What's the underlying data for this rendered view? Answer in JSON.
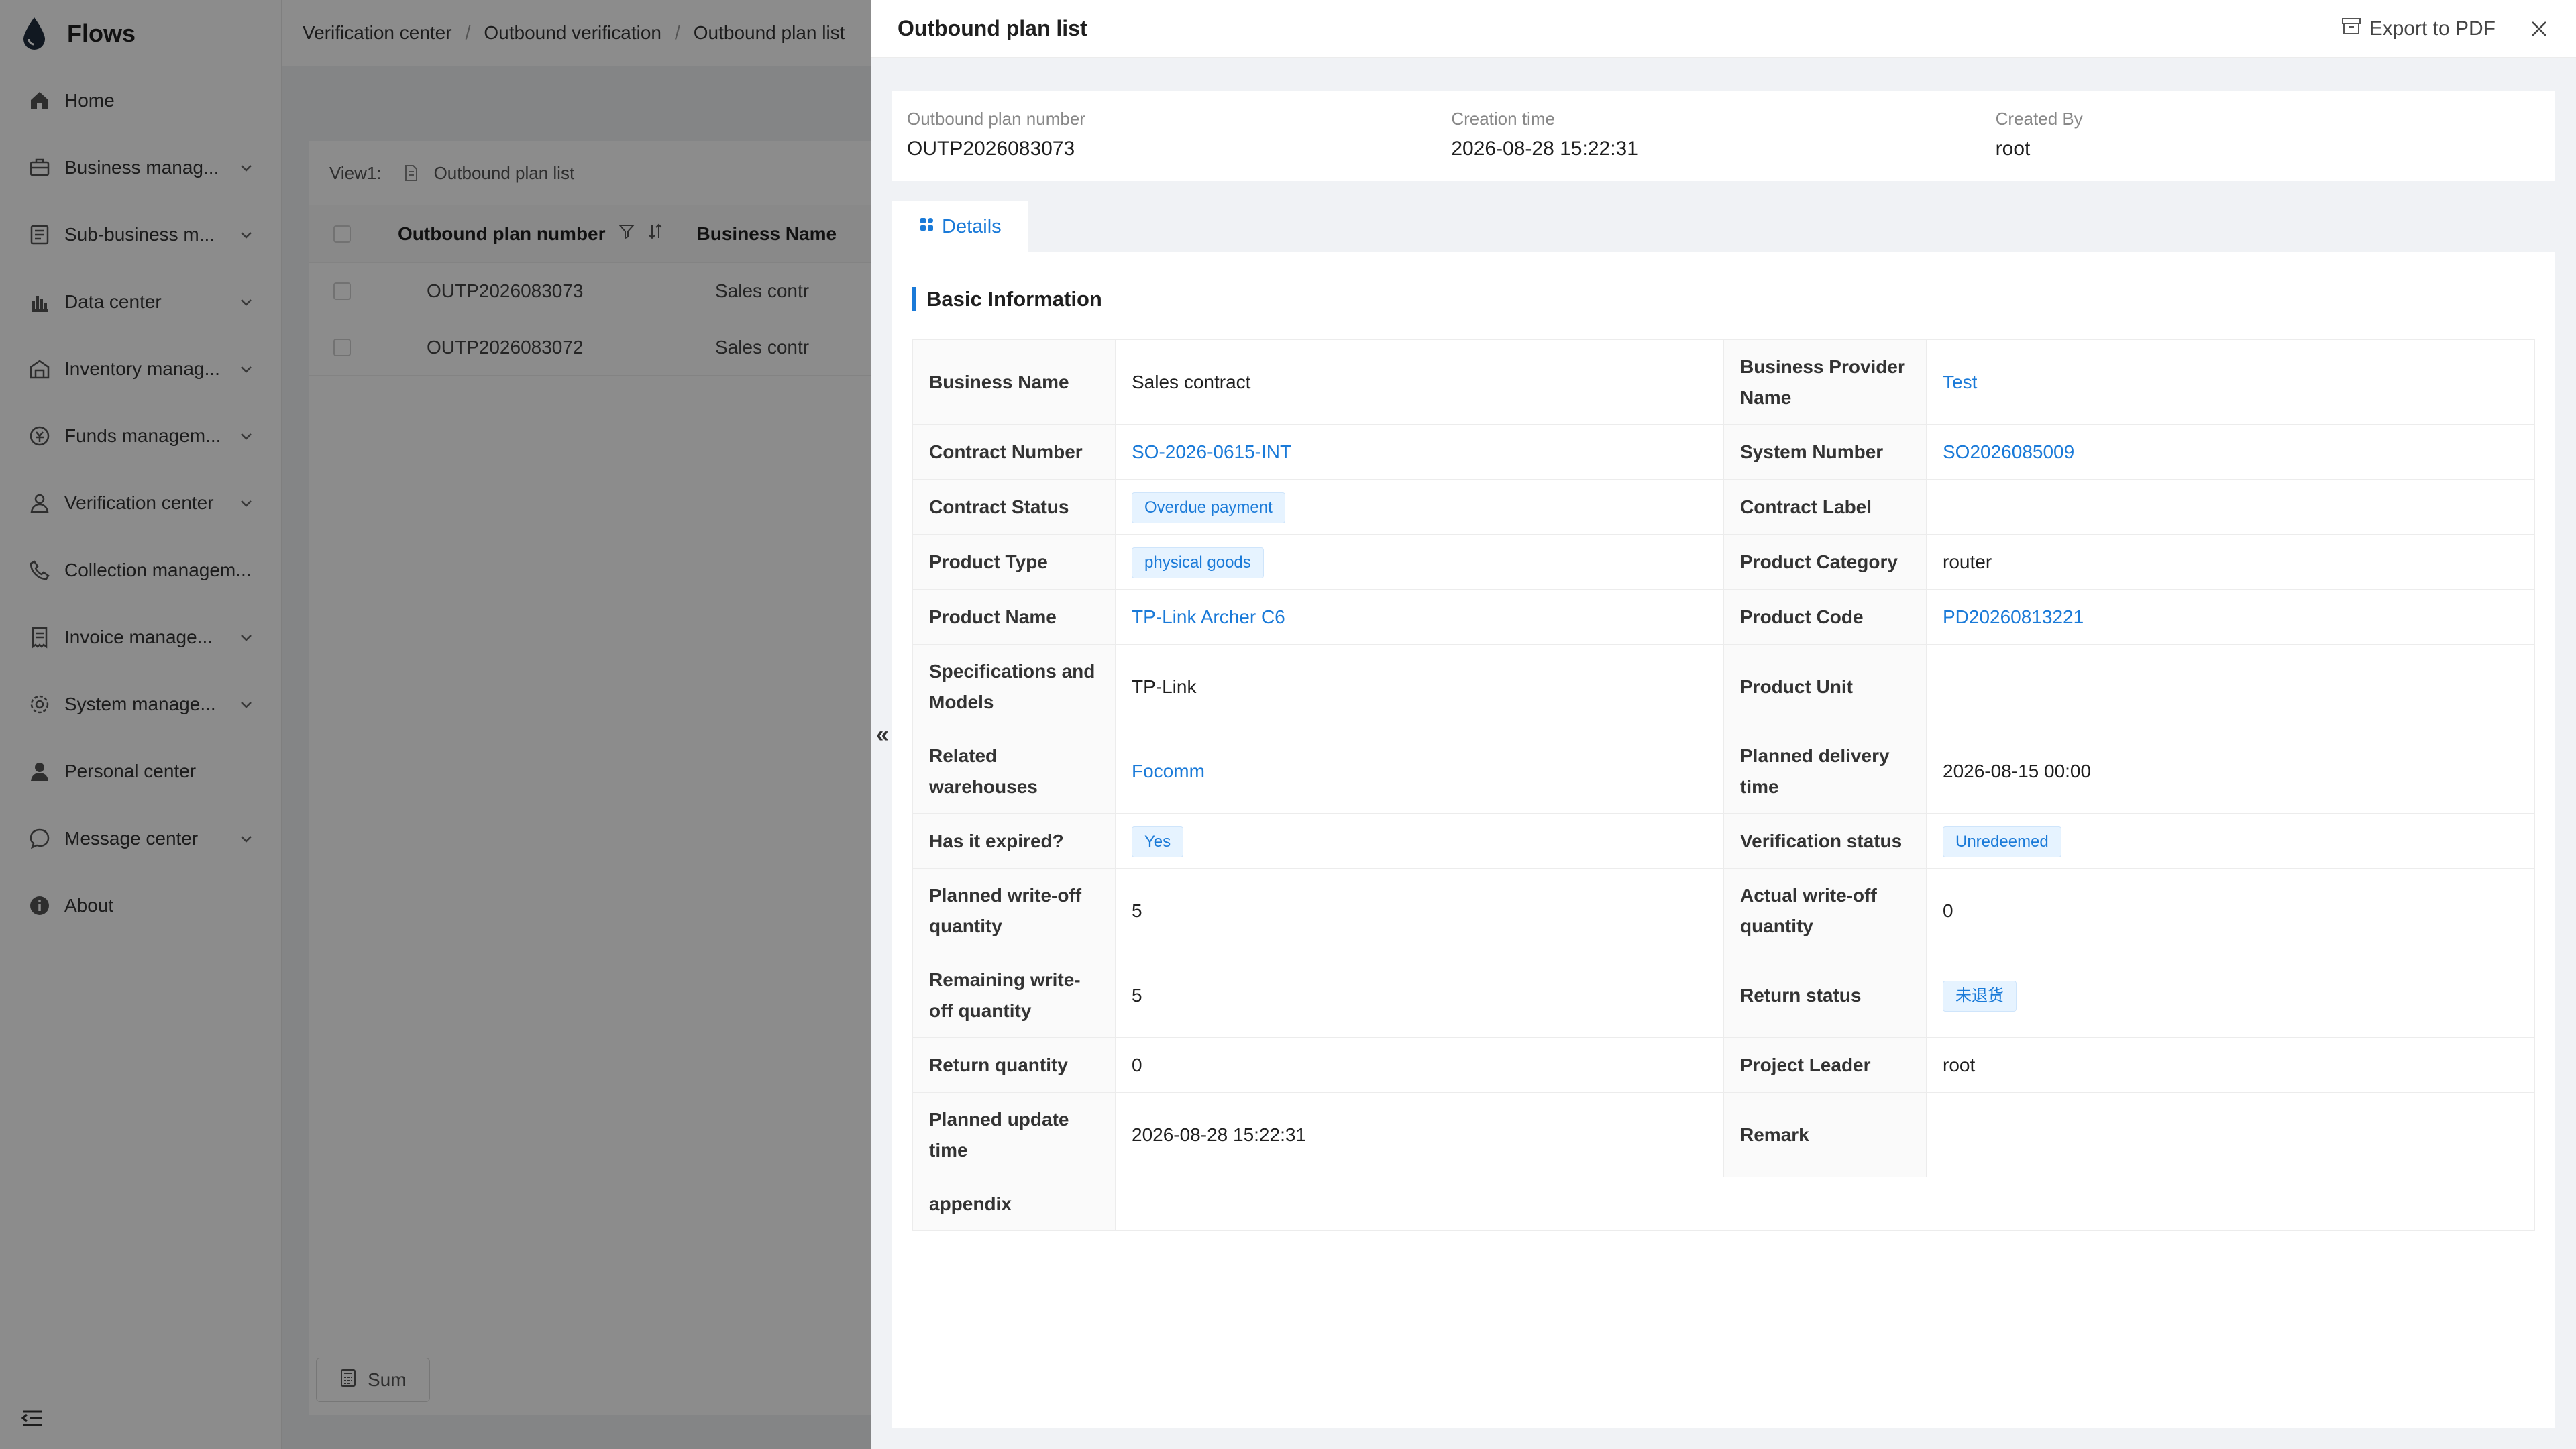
{
  "app": {
    "name": "Flows"
  },
  "sidebar": {
    "items": [
      {
        "label": "Home",
        "icon": "home-icon",
        "has_arrow": false
      },
      {
        "label": "Business manag...",
        "icon": "briefcase-icon",
        "has_arrow": true
      },
      {
        "label": "Sub-business m...",
        "icon": "list-icon",
        "has_arrow": true
      },
      {
        "label": "Data center",
        "icon": "bar-chart-icon",
        "has_arrow": true
      },
      {
        "label": "Inventory manag...",
        "icon": "warehouse-icon",
        "has_arrow": true
      },
      {
        "label": "Funds managem...",
        "icon": "coin-icon",
        "has_arrow": true
      },
      {
        "label": "Verification center",
        "icon": "user-check-icon",
        "has_arrow": true
      },
      {
        "label": "Collection managem...",
        "icon": "phone-icon",
        "has_arrow": false
      },
      {
        "label": "Invoice manage...",
        "icon": "invoice-icon",
        "has_arrow": true
      },
      {
        "label": "System manage...",
        "icon": "gear-icon",
        "has_arrow": true
      },
      {
        "label": "Personal center",
        "icon": "person-icon",
        "has_arrow": false
      },
      {
        "label": "Message center",
        "icon": "chat-icon",
        "has_arrow": true
      },
      {
        "label": "About",
        "icon": "info-icon",
        "has_arrow": false
      }
    ]
  },
  "breadcrumb": [
    "Verification center",
    "Outbound verification",
    "Outbound plan list"
  ],
  "breadcrumb_sep": "/",
  "list": {
    "view_label": "View1:",
    "view_name": "Outbound plan list",
    "columns": [
      "Outbound plan number",
      "Business Name"
    ],
    "rows": [
      {
        "number": "OUTP2026083073",
        "business": "Sales contr"
      },
      {
        "number": "OUTP2026083072",
        "business": "Sales contr"
      }
    ],
    "sum_label": "Sum"
  },
  "drawer": {
    "title": "Outbound plan list",
    "export_label": "Export to PDF",
    "summary": {
      "plan_number_label": "Outbound plan number",
      "plan_number": "OUTP2026083073",
      "creation_label": "Creation time",
      "creation_time": "2026-08-28 15:22:31",
      "created_by_label": "Created By",
      "created_by": "root"
    },
    "tab_label": "Details",
    "section_title": "Basic Information",
    "collapse_glyph": "«",
    "fields": {
      "business_name_label": "Business Name",
      "business_name": "Sales contract",
      "provider_label": "Business Provider Name",
      "provider": "Test",
      "contract_number_label": "Contract Number",
      "contract_number": "SO-2026-0615-INT",
      "system_number_label": "System Number",
      "system_number": "SO2026085009",
      "contract_status_label": "Contract Status",
      "contract_status": "Overdue payment",
      "contract_label_label": "Contract Label",
      "contract_label": "",
      "product_type_label": "Product Type",
      "product_type": "physical goods",
      "product_category_label": "Product Category",
      "product_category": "router",
      "product_name_label": "Product Name",
      "product_name": "TP-Link Archer C6",
      "product_code_label": "Product Code",
      "product_code": "PD20260813221",
      "spec_label": "Specifications and Models",
      "spec": "TP-Link",
      "unit_label": "Product Unit",
      "unit": "",
      "warehouse_label": "Related warehouses",
      "warehouse": "Focomm",
      "delivery_label": "Planned delivery time",
      "delivery": "2026-08-15 00:00",
      "expired_label": "Has it expired?",
      "expired": "Yes",
      "verification_label": "Verification status",
      "verification": "Unredeemed",
      "planned_qty_label": "Planned write-off quantity",
      "planned_qty": "5",
      "actual_qty_label": "Actual write-off quantity",
      "actual_qty": "0",
      "remaining_qty_label": "Remaining write-off quantity",
      "remaining_qty": "5",
      "return_status_label": "Return status",
      "return_status": "未退货",
      "return_qty_label": "Return quantity",
      "return_qty": "0",
      "leader_label": "Project Leader",
      "leader": "root",
      "update_time_label": "Planned update time",
      "update_time": "2026-08-28 15:22:31",
      "remark_label": "Remark",
      "remark": "",
      "appendix_label": "appendix",
      "appendix": ""
    }
  },
  "colors": {
    "accent": "#1a7ad8",
    "tag_bg": "#e6f3ff",
    "overlay": "rgba(0,0,0,0.45)"
  }
}
